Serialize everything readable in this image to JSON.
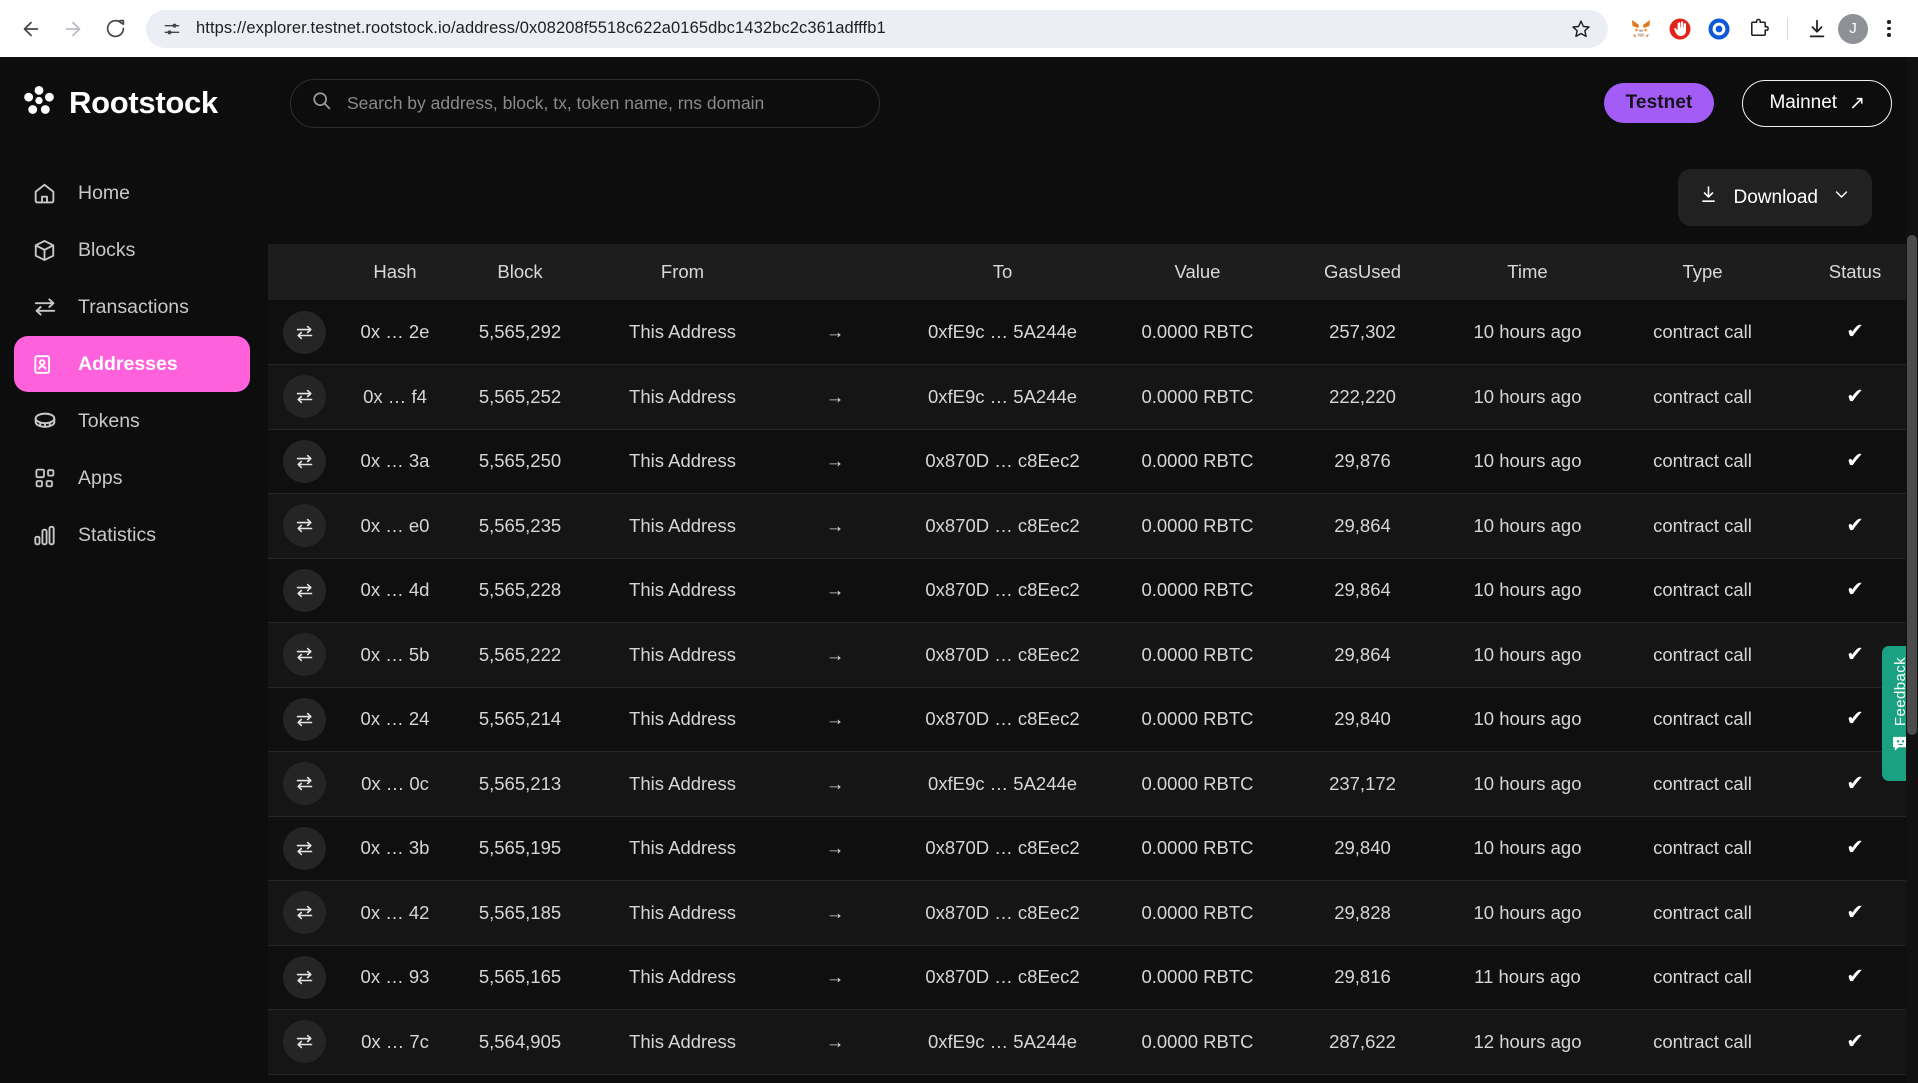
{
  "browser": {
    "url": "https://explorer.testnet.rootstock.io/address/0x08208f5518c622a0165dbc1432bc2c361adfffb1",
    "back_label": "Back",
    "forward_label": "Forward",
    "reload_label": "Reload",
    "site_info_label": "View site information",
    "bookmark_label": "Bookmark this tab",
    "extensions": [
      {
        "name": "metamask-extension-icon",
        "glyph": "🦊"
      },
      {
        "name": "adblock-extension-icon",
        "glyph": "✋"
      },
      {
        "name": "browser-extension-icon",
        "glyph": "◉"
      },
      {
        "name": "extensions-puzzle-icon",
        "glyph": "🧩"
      }
    ],
    "download_label": "Downloads",
    "profile_initial": "J",
    "menu_label": "Customize and control Chrome"
  },
  "header": {
    "brand": "Rootstock",
    "search_placeholder": "Search by address, block, tx, token name, rns domain",
    "search_value": "",
    "network_active": "Testnet",
    "network_other": "Mainnet",
    "network_other_arrow": "↗"
  },
  "sidebar": {
    "items": [
      {
        "label": "Home",
        "icon": "home-icon",
        "active": false
      },
      {
        "label": "Blocks",
        "icon": "cube-icon",
        "active": false
      },
      {
        "label": "Transactions",
        "icon": "transfer-arrows-icon",
        "active": false
      },
      {
        "label": "Addresses",
        "icon": "contact-card-icon",
        "active": true
      },
      {
        "label": "Tokens",
        "icon": "coin-icon",
        "active": false
      },
      {
        "label": "Apps",
        "icon": "grid-apps-icon",
        "active": false
      },
      {
        "label": "Statistics",
        "icon": "bar-chart-icon",
        "active": false
      }
    ],
    "active_color": "#ff61dd"
  },
  "toolbar": {
    "download_label": "Download",
    "download_icon": "download-icon",
    "chevron_icon": "chevron-down-icon"
  },
  "table": {
    "columns": [
      "Hash",
      "Block",
      "From",
      "To",
      "Value",
      "GasUsed",
      "Time",
      "Type",
      "Status"
    ],
    "arrow_glyph": "→",
    "status_glyph": "✔",
    "rows": [
      {
        "hash": "0x … 2e",
        "block": "5,565,292",
        "from": "This Address",
        "to": "0xfE9c … 5A244e",
        "value": "0.0000 RBTC",
        "gas": "257,302",
        "time": "10 hours ago",
        "type": "contract call",
        "status": "success"
      },
      {
        "hash": "0x … f4",
        "block": "5,565,252",
        "from": "This Address",
        "to": "0xfE9c … 5A244e",
        "value": "0.0000 RBTC",
        "gas": "222,220",
        "time": "10 hours ago",
        "type": "contract call",
        "status": "success"
      },
      {
        "hash": "0x … 3a",
        "block": "5,565,250",
        "from": "This Address",
        "to": "0x870D … c8Eec2",
        "value": "0.0000 RBTC",
        "gas": "29,876",
        "time": "10 hours ago",
        "type": "contract call",
        "status": "success"
      },
      {
        "hash": "0x … e0",
        "block": "5,565,235",
        "from": "This Address",
        "to": "0x870D … c8Eec2",
        "value": "0.0000 RBTC",
        "gas": "29,864",
        "time": "10 hours ago",
        "type": "contract call",
        "status": "success"
      },
      {
        "hash": "0x … 4d",
        "block": "5,565,228",
        "from": "This Address",
        "to": "0x870D … c8Eec2",
        "value": "0.0000 RBTC",
        "gas": "29,864",
        "time": "10 hours ago",
        "type": "contract call",
        "status": "success"
      },
      {
        "hash": "0x … 5b",
        "block": "5,565,222",
        "from": "This Address",
        "to": "0x870D … c8Eec2",
        "value": "0.0000 RBTC",
        "gas": "29,864",
        "time": "10 hours ago",
        "type": "contract call",
        "status": "success"
      },
      {
        "hash": "0x … 24",
        "block": "5,565,214",
        "from": "This Address",
        "to": "0x870D … c8Eec2",
        "value": "0.0000 RBTC",
        "gas": "29,840",
        "time": "10 hours ago",
        "type": "contract call",
        "status": "success"
      },
      {
        "hash": "0x … 0c",
        "block": "5,565,213",
        "from": "This Address",
        "to": "0xfE9c … 5A244e",
        "value": "0.0000 RBTC",
        "gas": "237,172",
        "time": "10 hours ago",
        "type": "contract call",
        "status": "success"
      },
      {
        "hash": "0x … 3b",
        "block": "5,565,195",
        "from": "This Address",
        "to": "0x870D … c8Eec2",
        "value": "0.0000 RBTC",
        "gas": "29,840",
        "time": "10 hours ago",
        "type": "contract call",
        "status": "success"
      },
      {
        "hash": "0x … 42",
        "block": "5,565,185",
        "from": "This Address",
        "to": "0x870D … c8Eec2",
        "value": "0.0000 RBTC",
        "gas": "29,828",
        "time": "10 hours ago",
        "type": "contract call",
        "status": "success"
      },
      {
        "hash": "0x … 93",
        "block": "5,565,165",
        "from": "This Address",
        "to": "0x870D … c8Eec2",
        "value": "0.0000 RBTC",
        "gas": "29,816",
        "time": "11 hours ago",
        "type": "contract call",
        "status": "success"
      },
      {
        "hash": "0x … 7c",
        "block": "5,564,905",
        "from": "This Address",
        "to": "0xfE9c … 5A244e",
        "value": "0.0000 RBTC",
        "gas": "287,622",
        "time": "12 hours ago",
        "type": "contract call",
        "status": "success"
      }
    ]
  },
  "feedback": {
    "label": "Feedback",
    "color": "#1aa181",
    "icon": "smiley-chat-icon"
  }
}
